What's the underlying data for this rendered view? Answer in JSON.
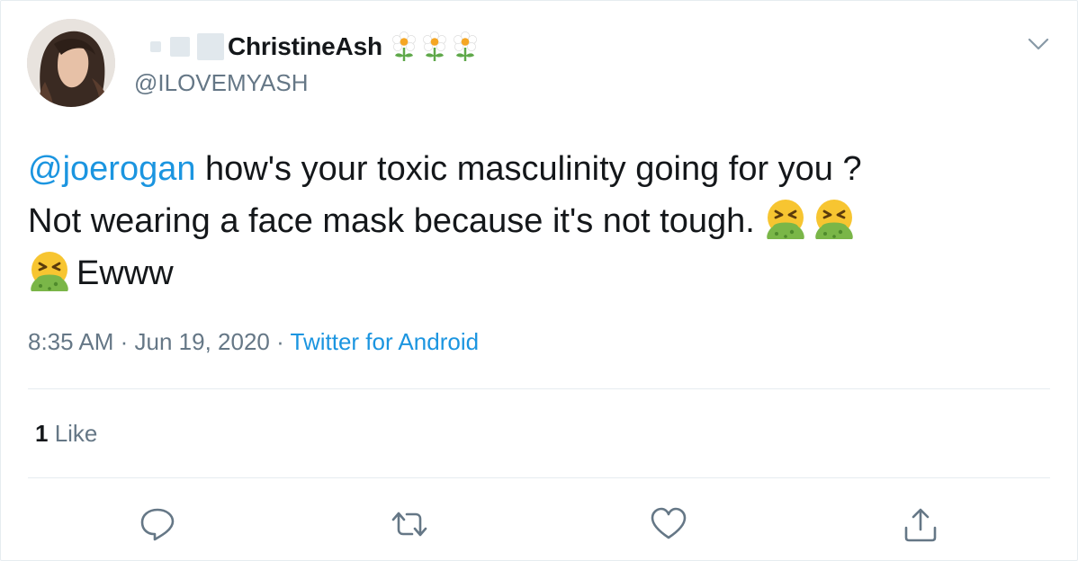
{
  "user": {
    "display_name": "ChristineAsh",
    "handle": "@ILOVEMYASH",
    "avatar_icon": "profile-photo",
    "name_decorations": [
      "flower-emoji",
      "flower-emoji",
      "flower-emoji"
    ]
  },
  "tweet": {
    "mention": "@joerogan",
    "line1_rest": " how's your toxic masculinity going for you ?",
    "line2": "Not wearing a face mask because it's not tough.",
    "line3_rest": "Ewww",
    "emoji_name": "vomiting-face-emoji"
  },
  "meta": {
    "time": "8:35 AM",
    "separator1": " · ",
    "date": "Jun 19, 2020",
    "separator2": " · ",
    "source": "Twitter for Android"
  },
  "stats": {
    "like_count": "1",
    "like_label": " Like"
  },
  "actions": {
    "reply_icon": "reply-icon",
    "retweet_icon": "retweet-icon",
    "like_icon": "heart-icon",
    "share_icon": "share-icon"
  },
  "colors": {
    "link": "#1b95e0",
    "secondary_text": "#657786",
    "primary_text": "#14171a",
    "divider": "#e6ecf0"
  }
}
